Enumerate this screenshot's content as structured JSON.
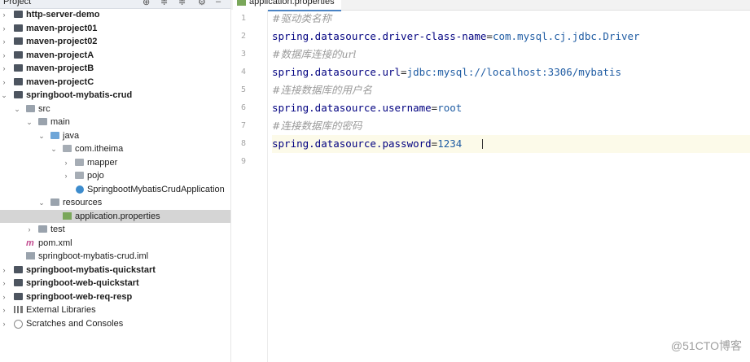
{
  "project_panel": {
    "title": "Project",
    "tree": [
      {
        "label": "http-server-demo",
        "bold": true
      },
      {
        "label": "maven-project01",
        "bold": true
      },
      {
        "label": "maven-project02",
        "bold": true
      },
      {
        "label": "maven-projectA",
        "bold": true
      },
      {
        "label": "maven-projectB",
        "bold": true
      },
      {
        "label": "maven-projectC",
        "bold": true
      },
      {
        "label": "springboot-mybatis-crud",
        "bold": true
      },
      {
        "label": "src",
        "bold": false
      },
      {
        "label": "main",
        "bold": false
      },
      {
        "label": "java",
        "bold": false
      },
      {
        "label": "com.itheima",
        "bold": false
      },
      {
        "label": "mapper",
        "bold": false
      },
      {
        "label": "pojo",
        "bold": false
      },
      {
        "label": "SpringbootMybatisCrudApplication",
        "bold": false
      },
      {
        "label": "resources",
        "bold": false
      },
      {
        "label": "application.properties",
        "bold": false,
        "selected": true
      },
      {
        "label": "test",
        "bold": false
      },
      {
        "label": "pom.xml",
        "bold": false
      },
      {
        "label": "springboot-mybatis-crud.iml",
        "bold": false
      },
      {
        "label": "springboot-mybatis-quickstart",
        "bold": true
      },
      {
        "label": "springboot-web-quickstart",
        "bold": true
      },
      {
        "label": "springboot-web-req-resp",
        "bold": true
      },
      {
        "label": "External Libraries",
        "bold": false
      },
      {
        "label": "Scratches and Consoles",
        "bold": false
      }
    ]
  },
  "editor": {
    "tab_label": "application.properties",
    "lines": [
      {
        "num": "1",
        "text": "#驱动类名称"
      },
      {
        "num": "2",
        "key": "spring.datasource.driver-class-name",
        "val": "com.mysql.cj.jdbc.Driver"
      },
      {
        "num": "3",
        "text": "#数据库连接的url"
      },
      {
        "num": "4",
        "key": "spring.datasource.url",
        "val": "jdbc:mysql://localhost:3306/mybatis"
      },
      {
        "num": "5",
        "text": "#连接数据库的用户名"
      },
      {
        "num": "6",
        "key": "spring.datasource.username",
        "val": "root"
      },
      {
        "num": "7",
        "text": "#连接数据库的密码"
      },
      {
        "num": "8",
        "key": "spring.datasource.password",
        "val": "1234"
      },
      {
        "num": "9",
        "text": ""
      }
    ]
  },
  "watermark": "@51CTO博客"
}
